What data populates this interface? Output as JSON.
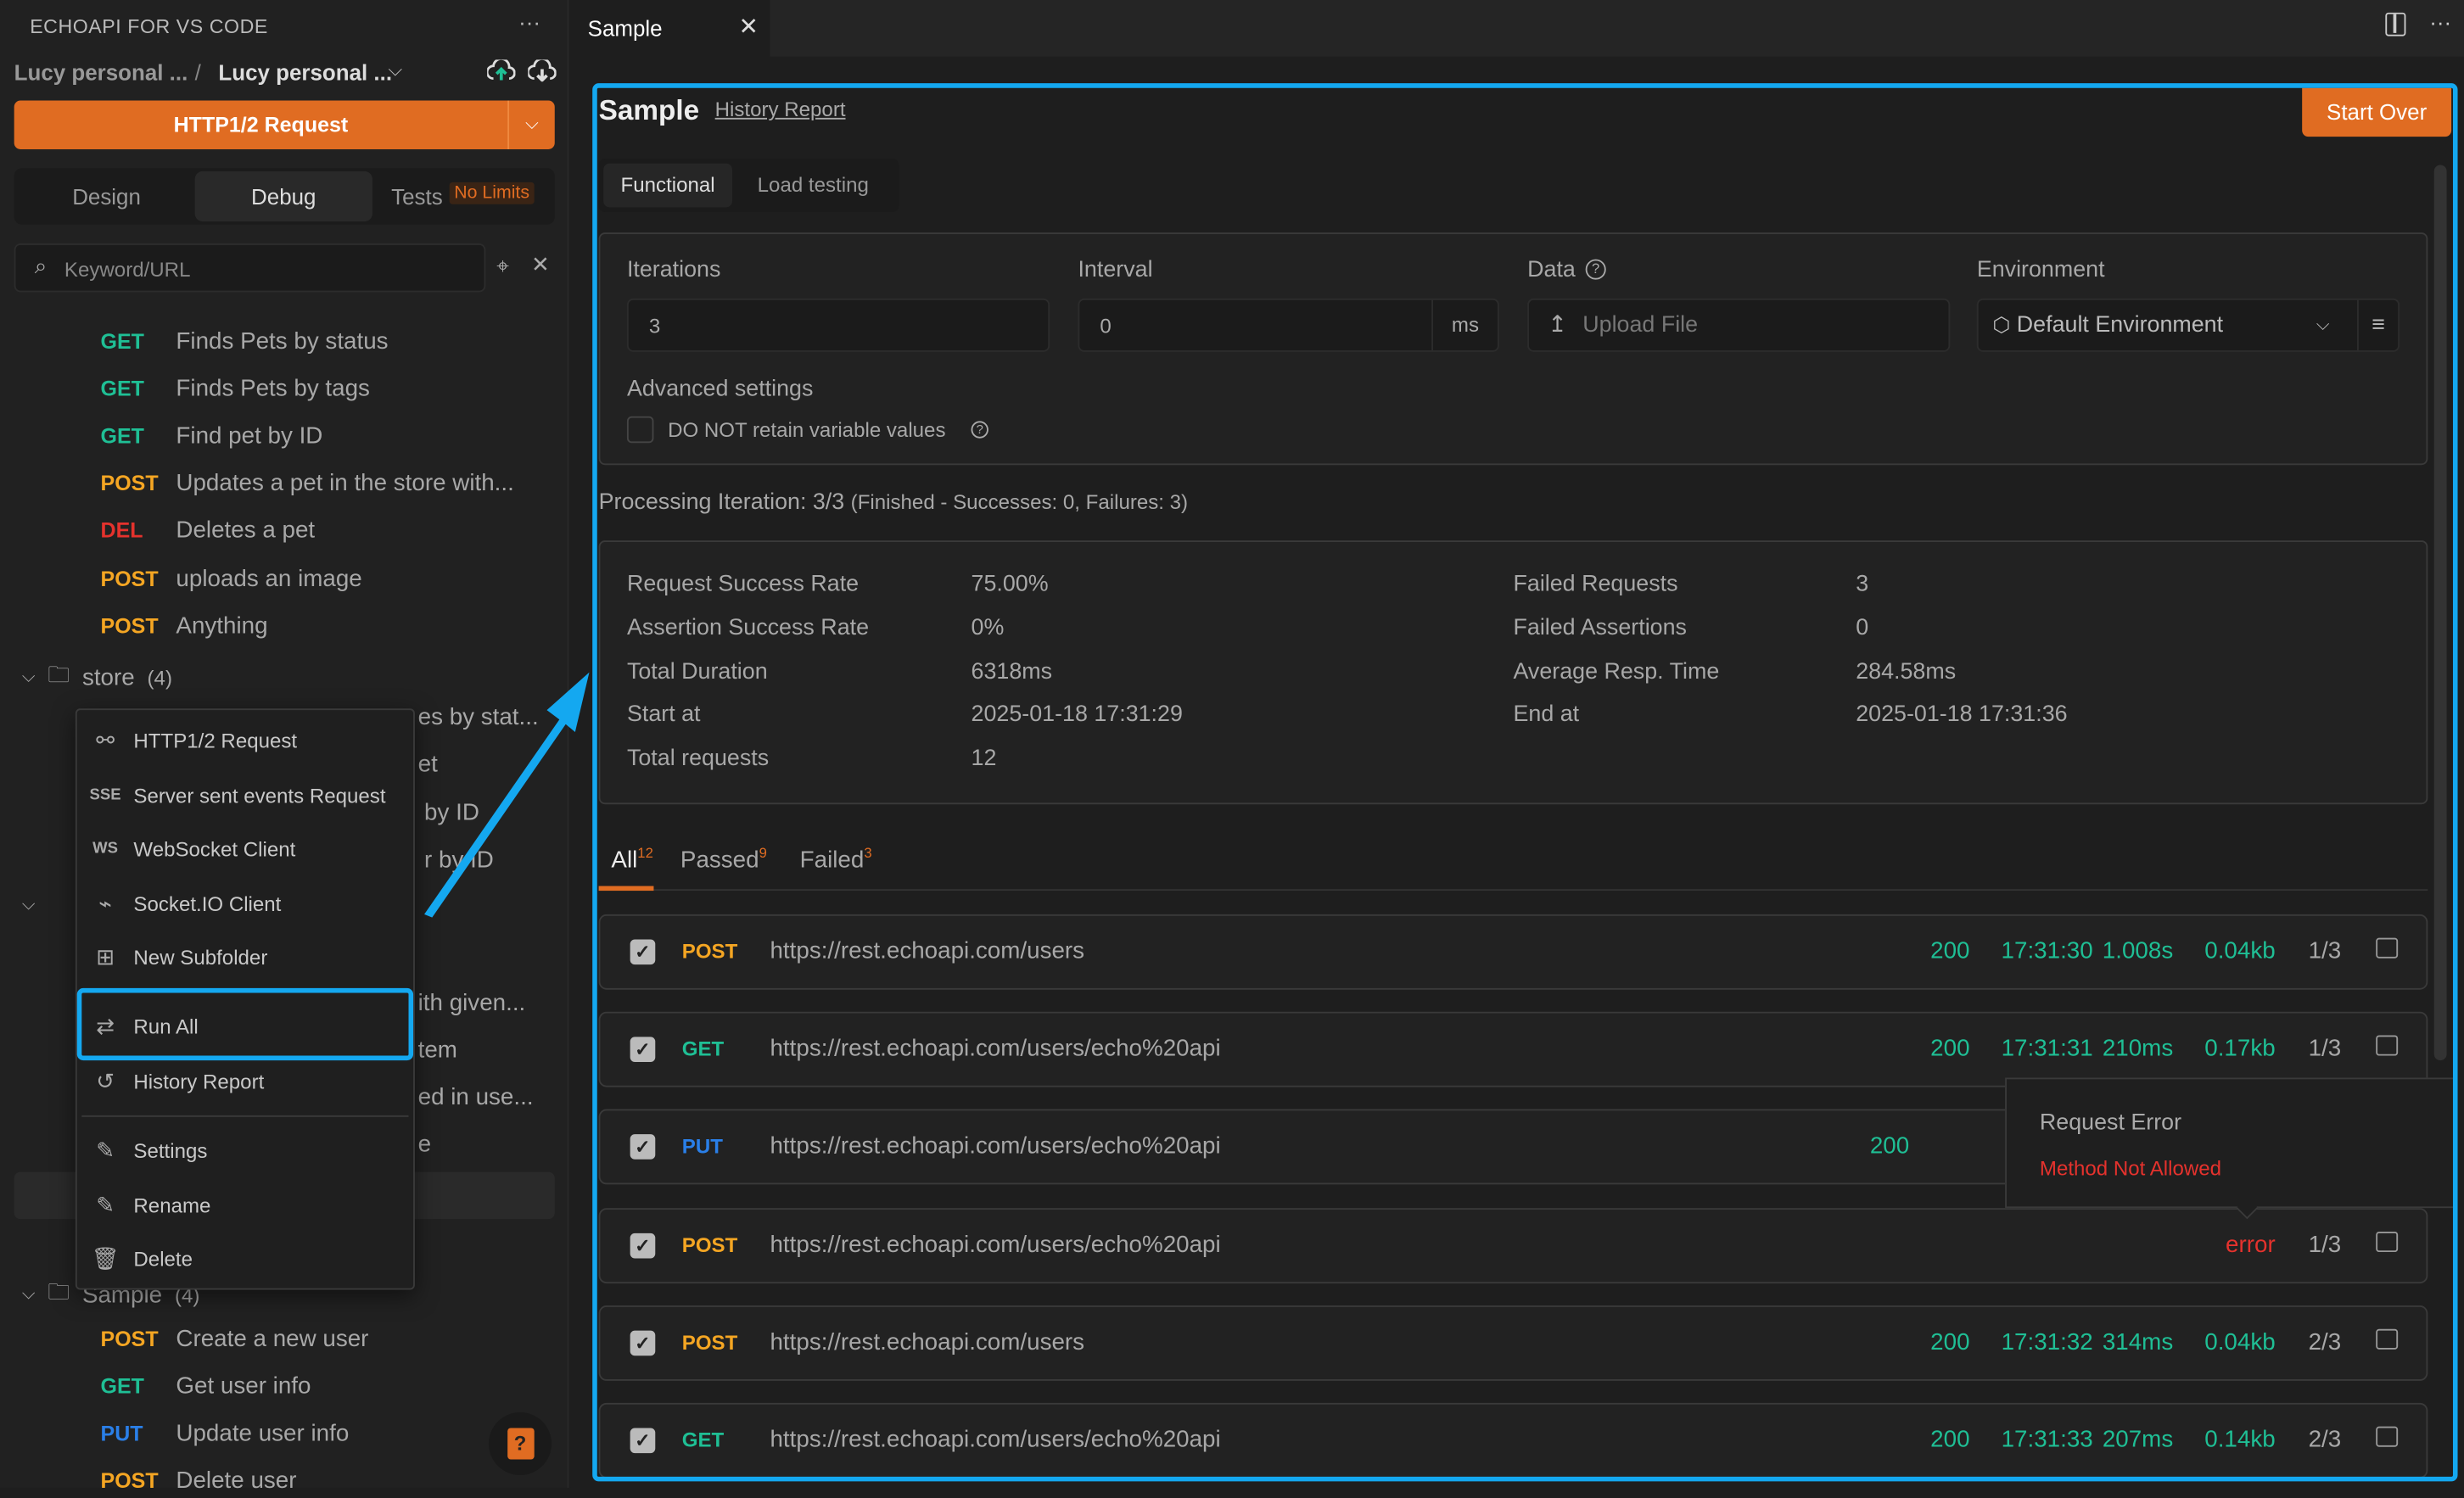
{
  "sidebar": {
    "title": "ECHOAPI FOR VS CODE",
    "breadcrumb": [
      "Lucy personal ...",
      "Lucy personal ..."
    ],
    "new_request_label": "HTTP1/2 Request",
    "tabs": [
      {
        "label": "Design"
      },
      {
        "label": "Debug",
        "active": true
      },
      {
        "label": "Tests",
        "badge": "No Limits"
      }
    ],
    "search_placeholder": "Keyword/URL",
    "items_top": [
      {
        "method": "GET",
        "name": "Finds Pets by status"
      },
      {
        "method": "GET",
        "name": "Finds Pets by tags"
      },
      {
        "method": "GET",
        "name": "Find pet by ID"
      },
      {
        "method": "POST",
        "name": "Updates a pet in the store with..."
      },
      {
        "method": "DEL",
        "name": "Deletes a pet"
      },
      {
        "method": "POST",
        "name": "uploads an image"
      },
      {
        "method": "POST",
        "name": "Anything"
      }
    ],
    "store_folder": {
      "name": "store",
      "count": "(4)"
    },
    "hidden_fragments": [
      "es by stat...",
      "et",
      "by ID",
      "r by ID",
      "ith given...",
      "tem",
      "ed in use...",
      "e"
    ],
    "sample_folder": {
      "name": "Sample",
      "count": "(4)"
    },
    "sample_items": [
      {
        "method": "POST",
        "name": "Create a new user"
      },
      {
        "method": "GET",
        "name": "Get user info"
      },
      {
        "method": "PUT",
        "name": "Update user info"
      },
      {
        "method": "POST",
        "name": "Delete user"
      }
    ]
  },
  "context_menu": {
    "items": [
      {
        "icon": "plug-icon",
        "label": "HTTP1/2 Request"
      },
      {
        "icon": "SSE",
        "label": "Server sent events Request"
      },
      {
        "icon": "WS",
        "label": "WebSocket Client"
      },
      {
        "icon": "socketio-icon",
        "label": "Socket.IO Client"
      },
      {
        "icon": "folder-plus-icon",
        "label": "New Subfolder"
      },
      {
        "icon": "run-all-icon",
        "label": "Run All",
        "highlighted": true
      },
      {
        "icon": "history-icon",
        "label": "History Report"
      },
      {
        "icon": "edit-icon",
        "label": "Settings"
      },
      {
        "icon": "edit-icon",
        "label": "Rename"
      },
      {
        "icon": "trash-icon",
        "label": "Delete"
      }
    ]
  },
  "editor": {
    "tab_label": "Sample"
  },
  "runner": {
    "title": "Sample",
    "history_link": "History Report",
    "start_over": "Start Over",
    "mode_tabs": [
      "Functional",
      "Load testing"
    ],
    "iterations": {
      "label": "Iterations",
      "value": "3"
    },
    "interval": {
      "label": "Interval",
      "value": "0",
      "unit": "ms"
    },
    "data": {
      "label": "Data",
      "placeholder": "Upload File"
    },
    "environment": {
      "label": "Environment",
      "value": "Default Environment"
    },
    "advanced_label": "Advanced settings",
    "retain_checkbox": {
      "label": "DO NOT retain variable values",
      "checked": false
    },
    "progress": {
      "main": "Processing Iteration: 3/3",
      "detail": "(Finished - Successes: 0, Failures: 3)"
    },
    "stats": [
      {
        "label": "Request Success Rate",
        "value": "75.00%"
      },
      {
        "label": "Failed Requests",
        "value": "3"
      },
      {
        "label": "Assertion Success Rate",
        "value": "0%"
      },
      {
        "label": "Failed Assertions",
        "value": "0"
      },
      {
        "label": "Total Duration",
        "value": "6318ms"
      },
      {
        "label": "Average Resp. Time",
        "value": "284.58ms"
      },
      {
        "label": "Start at",
        "value": "2025-01-18 17:31:29"
      },
      {
        "label": "End at",
        "value": "2025-01-18 17:31:36"
      },
      {
        "label": "Total requests",
        "value": "12"
      }
    ],
    "result_tabs": [
      {
        "label": "All",
        "count": "12"
      },
      {
        "label": "Passed",
        "count": "9"
      },
      {
        "label": "Failed",
        "count": "3"
      }
    ],
    "results": [
      {
        "method": "POST",
        "url": "https://rest.echoapi.com/users",
        "status": "200",
        "time": "17:31:30",
        "duration": "1.008s",
        "size": "0.04kb",
        "iter": "1/3"
      },
      {
        "method": "GET",
        "url": "https://rest.echoapi.com/users/echo%20api",
        "status": "200",
        "time": "17:31:31",
        "duration": "210ms",
        "size": "0.17kb",
        "iter": "1/3"
      },
      {
        "method": "PUT",
        "url": "https://rest.echoapi.com/users/echo%20api",
        "status": "200",
        "time": "",
        "duration": "",
        "size": "",
        "iter": ""
      },
      {
        "method": "POST",
        "url": "https://rest.echoapi.com/users/echo%20api",
        "status": "error",
        "time": "",
        "duration": "",
        "size": "",
        "iter": "1/3"
      },
      {
        "method": "POST",
        "url": "https://rest.echoapi.com/users",
        "status": "200",
        "time": "17:31:32",
        "duration": "314ms",
        "size": "0.04kb",
        "iter": "2/3"
      },
      {
        "method": "GET",
        "url": "https://rest.echoapi.com/users/echo%20api",
        "status": "200",
        "time": "17:31:33",
        "duration": "207ms",
        "size": "0.14kb",
        "iter": "2/3"
      }
    ],
    "tooltip": {
      "title": "Request Error",
      "message": "Method Not Allowed"
    }
  },
  "colors": {
    "accent": "#e06c22",
    "highlight": "#14a8f0",
    "get": "#1fbf95",
    "post": "#f5a623",
    "del": "#e5322d",
    "put": "#2a7fe8",
    "error": "#e5322d"
  }
}
